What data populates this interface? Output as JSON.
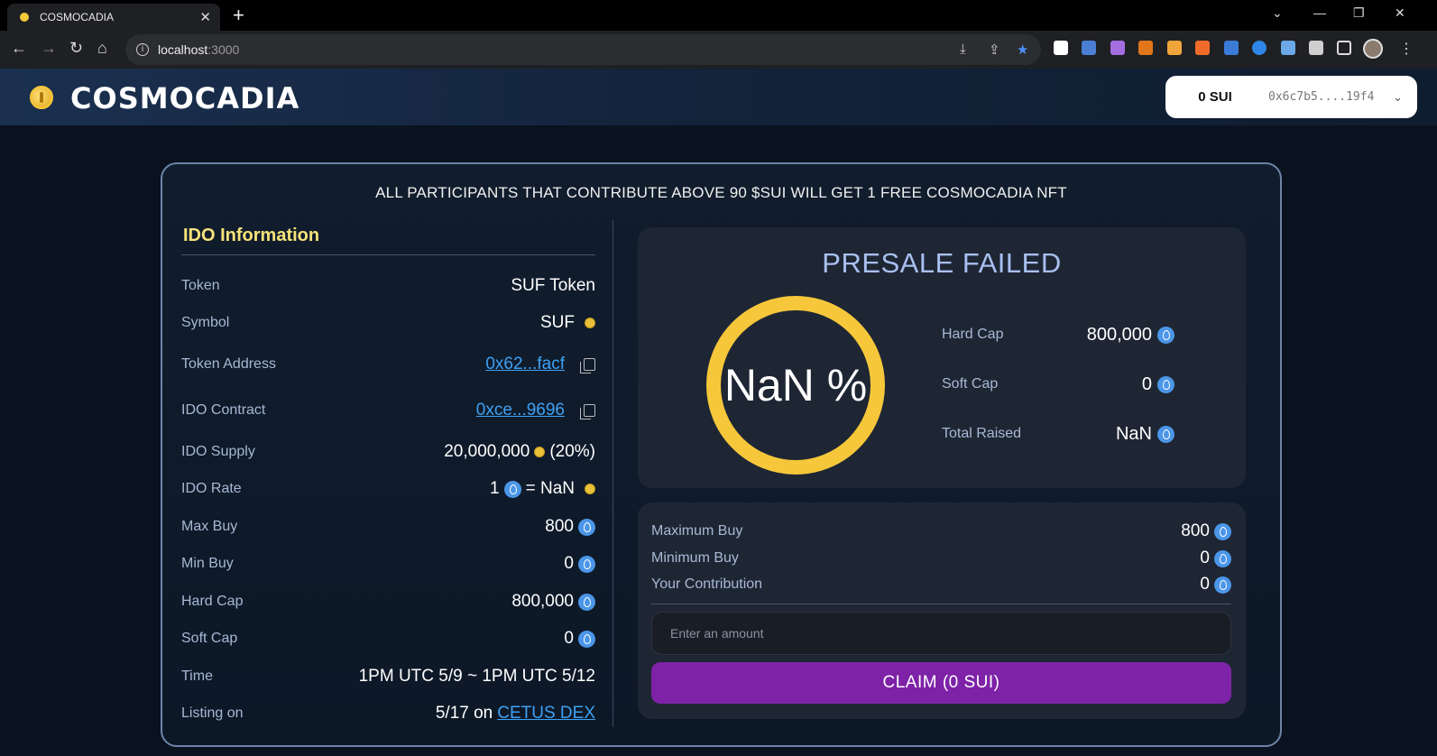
{
  "browser": {
    "tab_title": "COSMOCADIA",
    "url_host": "localhost",
    "url_port": ":3000"
  },
  "header": {
    "brand": "COSMOCADIA",
    "wallet_balance": "0 SUI",
    "wallet_address": "0x6c7b5....19f4"
  },
  "banner": "ALL PARTICIPANTS THAT CONTRIBUTE ABOVE 90 $SUI WILL GET 1 FREE COSMOCADIA NFT",
  "ido": {
    "title": "IDO Information",
    "token_label": "Token",
    "token_value": "SUF Token",
    "symbol_label": "Symbol",
    "symbol_value": "SUF",
    "address_label": "Token Address",
    "address_value": "0x62...facf",
    "contract_label": "IDO Contract",
    "contract_value": "0xce...9696",
    "supply_label": "IDO Supply",
    "supply_value": "20,000,000",
    "supply_pct": "(20%)",
    "rate_label": "IDO Rate",
    "rate_left": "1",
    "rate_eq": "= NaN",
    "maxbuy_label": "Max Buy",
    "maxbuy_value": "800",
    "minbuy_label": "Min Buy",
    "minbuy_value": "0",
    "hardcap_label": "Hard Cap",
    "hardcap_value": "800,000",
    "softcap_label": "Soft Cap",
    "softcap_value": "0",
    "time_label": "Time",
    "time_value": "1PM UTC 5/9 ~ 1PM UTC 5/12",
    "listing_label": "Listing on",
    "listing_date": "5/17 on",
    "listing_link": "CETUS DEX"
  },
  "status": {
    "title": "PRESALE FAILED",
    "progress": "NaN %",
    "hardcap_label": "Hard Cap",
    "hardcap_value": "800,000",
    "softcap_label": "Soft Cap",
    "softcap_value": "0",
    "raised_label": "Total Raised",
    "raised_value": "NaN"
  },
  "buy": {
    "max_label": "Maximum Buy",
    "max_value": "800",
    "min_label": "Minimum Buy",
    "min_value": "0",
    "contrib_label": "Your Contribution",
    "contrib_value": "0",
    "amount_placeholder": "Enter an amount",
    "claim_label": "CLAIM (0 SUI)"
  },
  "colors": {
    "accent_gold": "#f6c73a",
    "claim_purple": "#7e22a8",
    "link_blue": "#3ea1f5",
    "status_title": "#a9bff0"
  }
}
